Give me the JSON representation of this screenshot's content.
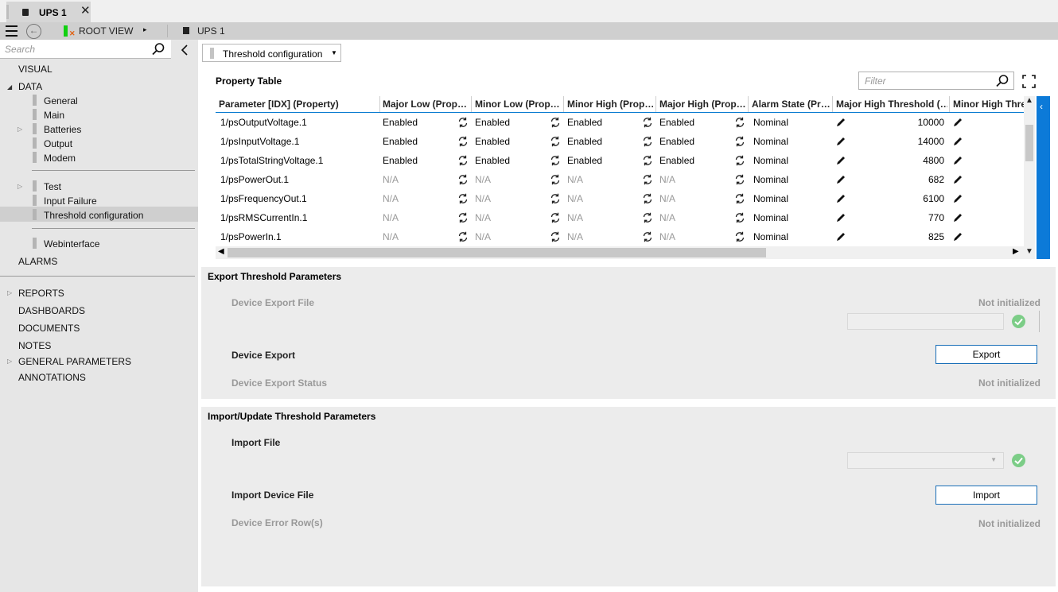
{
  "tab": {
    "title": "UPS 1",
    "close": "✕"
  },
  "toolbar": {
    "back": "←",
    "root_label": "ROOT VIEW",
    "arrow": "▸",
    "current": "UPS 1"
  },
  "sidebar": {
    "search_placeholder": "Search",
    "visual": "VISUAL",
    "data": "DATA",
    "data_children": {
      "general": "General",
      "main": "Main",
      "batteries": "Batteries",
      "output": "Output",
      "modem": "Modem"
    },
    "group2": {
      "test": "Test",
      "input_failure": "Input Failure",
      "threshold": "Threshold configuration"
    },
    "webinterface": "Webinterface",
    "alarms": "ALARMS",
    "reports": "REPORTS",
    "dashboards": "DASHBOARDS",
    "documents": "DOCUMENTS",
    "notes": "NOTES",
    "general_parameters": "GENERAL PARAMETERS",
    "annotations": "ANNOTATIONS"
  },
  "view_selector": {
    "label": "Threshold configuration"
  },
  "property_table": {
    "title": "Property Table",
    "filter_placeholder": "Filter",
    "headers": {
      "param": "Parameter [IDX] (Property)",
      "major_low": "Major Low (Prop…",
      "minor_low": "Minor Low (Prop…",
      "minor_high": "Minor High (Prop…",
      "major_high": "Major High (Prop…",
      "alarm_state": "Alarm State (Pr…",
      "major_high_threshold": "Major High Threshold (…",
      "minor_high_threshold": "Minor High Thre…"
    },
    "rows": [
      {
        "param": "1/psOutputVoltage.1",
        "major_low": "Enabled",
        "minor_low": "Enabled",
        "minor_high": "Enabled",
        "major_high": "Enabled",
        "alarm_state": "Nominal",
        "threshold": "10000"
      },
      {
        "param": "1/psInputVoltage.1",
        "major_low": "Enabled",
        "minor_low": "Enabled",
        "minor_high": "Enabled",
        "major_high": "Enabled",
        "alarm_state": "Nominal",
        "threshold": "14000"
      },
      {
        "param": "1/psTotalStringVoltage.1",
        "major_low": "Enabled",
        "minor_low": "Enabled",
        "minor_high": "Enabled",
        "major_high": "Enabled",
        "alarm_state": "Nominal",
        "threshold": "4800"
      },
      {
        "param": "1/psPowerOut.1",
        "major_low": "N/A",
        "minor_low": "N/A",
        "minor_high": "N/A",
        "major_high": "N/A",
        "alarm_state": "Nominal",
        "threshold": "682"
      },
      {
        "param": "1/psFrequencyOut.1",
        "major_low": "N/A",
        "minor_low": "N/A",
        "minor_high": "N/A",
        "major_high": "N/A",
        "alarm_state": "Nominal",
        "threshold": "6100"
      },
      {
        "param": "1/psRMSCurrentIn.1",
        "major_low": "N/A",
        "minor_low": "N/A",
        "minor_high": "N/A",
        "major_high": "N/A",
        "alarm_state": "Nominal",
        "threshold": "770"
      },
      {
        "param": "1/psPowerIn.1",
        "major_low": "N/A",
        "minor_low": "N/A",
        "minor_high": "N/A",
        "major_high": "N/A",
        "alarm_state": "Nominal",
        "threshold": "825"
      }
    ]
  },
  "export_panel": {
    "title": "Export Threshold Parameters",
    "device_export_file": "Device Export File",
    "device_export_file_value": "Not initialized",
    "device_export": "Device Export",
    "export_button": "Export",
    "device_export_status": "Device Export Status",
    "device_export_status_value": "Not initialized"
  },
  "import_panel": {
    "title": "Import/Update Threshold Parameters",
    "import_file": "Import File",
    "import_device_file": "Import Device File",
    "import_button": "Import",
    "device_error_rows": "Device Error Row(s)",
    "device_error_rows_value": "Not initialized"
  },
  "colors": {
    "accent": "#0c7ad8",
    "selection": "#cfcfcf",
    "sidebar": "#e6e6e6",
    "panel": "#ececec",
    "check": "#4cbb5a"
  }
}
